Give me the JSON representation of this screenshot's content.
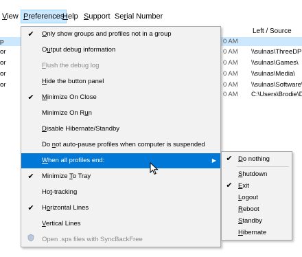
{
  "menubar": {
    "items": [
      {
        "pre": "",
        "ul": "V",
        "post": "iew",
        "active": false
      },
      {
        "pre": "",
        "ul": "P",
        "post": "references",
        "active": true
      },
      {
        "pre": "",
        "ul": "H",
        "post": "elp",
        "active": false
      },
      {
        "pre": "",
        "ul": "S",
        "post": "upport",
        "active": false
      },
      {
        "pre": "Se",
        "ul": "r",
        "post": "ial Number",
        "active": false
      }
    ]
  },
  "list": {
    "column_header": "Left / Source",
    "rows": [
      {
        "left": "p",
        "time": "",
        "source": ""
      },
      {
        "left": "or",
        "time": "0 AM",
        "source": ""
      },
      {
        "left": "or",
        "time": "0 AM",
        "source": "\\\\sulnas\\ThreeDPr"
      },
      {
        "left": "or",
        "time": "0 AM",
        "source": "\\\\sulnas\\Games\\"
      },
      {
        "left": "or",
        "time": "0 AM",
        "source": "\\\\sulnas\\Media\\"
      },
      {
        "left": "or",
        "time": "0 AM",
        "source": "\\\\sulnas\\Software\\"
      },
      {
        "left": "",
        "time": "0 AM",
        "source": "C:\\Users\\Brodie\\D"
      }
    ]
  },
  "preferences_menu": {
    "items": [
      {
        "pre": "",
        "ul": "O",
        "post": "nly show groups and profiles not in a group",
        "checked": true,
        "disabled": false,
        "highlight": false,
        "submenu": false
      },
      {
        "pre": "O",
        "ul": "u",
        "post": "tput debug information",
        "checked": false,
        "disabled": false,
        "highlight": false,
        "submenu": false
      },
      {
        "pre": "",
        "ul": "F",
        "post": "lush the debug log",
        "checked": false,
        "disabled": true,
        "highlight": false,
        "submenu": false
      },
      {
        "pre": "",
        "ul": "H",
        "post": "ide the button panel",
        "checked": false,
        "disabled": false,
        "highlight": false,
        "submenu": false
      },
      {
        "pre": "",
        "ul": "M",
        "post": "inimize On Close",
        "checked": true,
        "disabled": false,
        "highlight": false,
        "submenu": false
      },
      {
        "pre": "Minimize On R",
        "ul": "u",
        "post": "n",
        "checked": false,
        "disabled": false,
        "highlight": false,
        "submenu": false
      },
      {
        "pre": "",
        "ul": "D",
        "post": "isable Hibernate/Standby",
        "checked": false,
        "disabled": false,
        "highlight": false,
        "submenu": false
      },
      {
        "pre": "Do ",
        "ul": "n",
        "post": "ot auto-pause profiles when computer is suspended",
        "checked": false,
        "disabled": false,
        "highlight": false,
        "submenu": false
      },
      {
        "pre": "",
        "ul": "W",
        "post": "hen all profiles end:",
        "checked": false,
        "disabled": false,
        "highlight": true,
        "submenu": true
      },
      {
        "pre": "Minimize ",
        "ul": "T",
        "post": "o Tray",
        "checked": true,
        "disabled": false,
        "highlight": false,
        "submenu": false
      },
      {
        "pre": "Ho",
        "ul": "t",
        "post": "-tracking",
        "checked": false,
        "disabled": false,
        "highlight": false,
        "submenu": false
      },
      {
        "pre": "H",
        "ul": "o",
        "post": "rizontal Lines",
        "checked": true,
        "disabled": false,
        "highlight": false,
        "submenu": false
      },
      {
        "pre": "",
        "ul": "V",
        "post": "ertical Lines",
        "checked": false,
        "disabled": false,
        "highlight": false,
        "submenu": false
      },
      {
        "pre": "Open .sps files with SyncBackFree",
        "ul": "",
        "post": "",
        "checked": false,
        "disabled": true,
        "highlight": false,
        "submenu": false,
        "shield_icon": true
      }
    ]
  },
  "profiles_end_submenu": {
    "items": [
      {
        "pre": "",
        "ul": "D",
        "post": "o nothing",
        "checked": true
      },
      {
        "pre": "",
        "ul": "S",
        "post": "hutdown",
        "checked": false
      },
      {
        "pre": "",
        "ul": "E",
        "post": "xit",
        "checked": true
      },
      {
        "pre": "",
        "ul": "L",
        "post": "ogout",
        "checked": false
      },
      {
        "pre": "",
        "ul": "R",
        "post": "eboot",
        "checked": false
      },
      {
        "pre": "",
        "ul": "S",
        "post": "tandby",
        "checked": false
      },
      {
        "pre": "",
        "ul": "H",
        "post": "ibernate",
        "checked": false
      }
    ]
  },
  "colors": {
    "highlight": "#0078d7",
    "active_menu": "#cce8ff",
    "menu_bg": "#f2f2f2",
    "disabled_text": "#8a8a8a"
  },
  "icons": {
    "check": "checkmark-icon",
    "submenu_arrow": "chevron-right-icon",
    "cursor": "mouse-pointer-icon",
    "shield": "shield-icon"
  }
}
